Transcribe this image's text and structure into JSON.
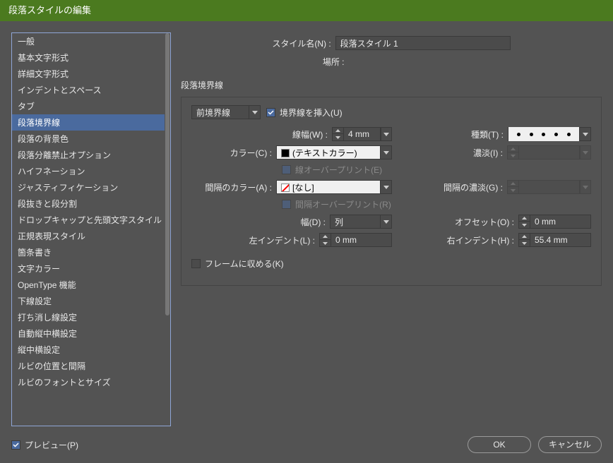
{
  "title": "段落スタイルの編集",
  "sidebar": {
    "items": [
      {
        "label": "一般"
      },
      {
        "label": "基本文字形式"
      },
      {
        "label": "詳細文字形式"
      },
      {
        "label": "インデントとスペース"
      },
      {
        "label": "タブ"
      },
      {
        "label": "段落境界線"
      },
      {
        "label": "段落の背景色"
      },
      {
        "label": "段落分離禁止オプション"
      },
      {
        "label": "ハイフネーション"
      },
      {
        "label": "ジャスティフィケーション"
      },
      {
        "label": "段抜きと段分割"
      },
      {
        "label": "ドロップキャップと先頭文字スタイル"
      },
      {
        "label": "正規表現スタイル"
      },
      {
        "label": "箇条書き"
      },
      {
        "label": "文字カラー"
      },
      {
        "label": "OpenType 機能"
      },
      {
        "label": "下線設定"
      },
      {
        "label": "打ち消し線設定"
      },
      {
        "label": "自動縦中横設定"
      },
      {
        "label": "縦中横設定"
      },
      {
        "label": "ルビの位置と間隔"
      },
      {
        "label": "ルビのフォントとサイズ"
      }
    ]
  },
  "top": {
    "style_name_label": "スタイル名(N) :",
    "style_name_value": "段落スタイル 1",
    "location_label": "場所 :"
  },
  "section": {
    "title": "段落境界線",
    "rule_select": "前境界線",
    "rule_on_label": "境界線を挿入(U)",
    "weight_label": "線幅(W) :",
    "weight_value": "4 mm",
    "type_label": "種類(T) :",
    "color_label": "カラー(C) :",
    "color_value": "(テキストカラー)",
    "tint_label": "濃淡(I) :",
    "overprint_stroke_label": "線オーバープリント(E)",
    "gap_color_label": "間隔のカラー(A) :",
    "gap_color_value": "[なし]",
    "gap_tint_label": "間隔の濃淡(G) :",
    "overprint_gap_label": "間隔オーバープリント(R)",
    "width_label": "幅(D) :",
    "width_value": "列",
    "offset_label": "オフセット(O) :",
    "offset_value": "0 mm",
    "left_indent_label": "左インデント(L) :",
    "left_indent_value": "0 mm",
    "right_indent_label": "右インデント(H) :",
    "right_indent_value": "55.4 mm",
    "keep_in_frame_label": "フレームに収める(K)"
  },
  "footer": {
    "preview_label": "プレビュー(P)",
    "ok_label": "OK",
    "cancel_label": "キャンセル"
  }
}
